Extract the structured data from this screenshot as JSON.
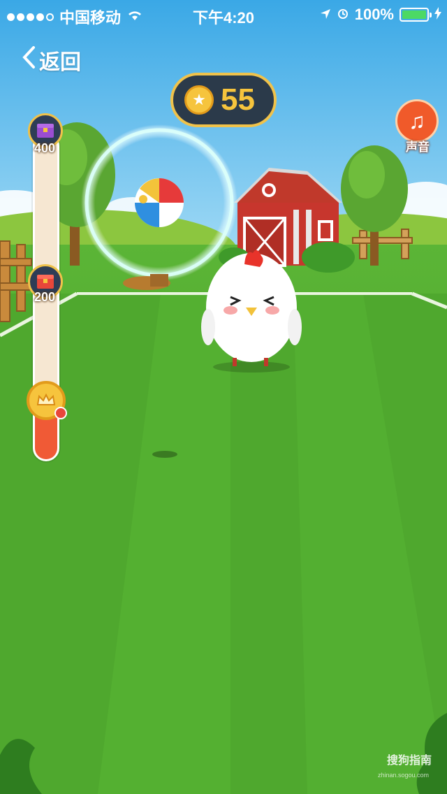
{
  "status_bar": {
    "carrier": "中国移动",
    "time": "下午4:20",
    "battery": "100%",
    "signal_bars_filled": 4,
    "signal_bars_total": 5
  },
  "nav": {
    "back_label": "返回"
  },
  "coins": {
    "value": "55"
  },
  "sound": {
    "label": "声音"
  },
  "progress": {
    "milestones": [
      "400",
      "200"
    ],
    "fill_fraction": 0.2
  },
  "watermark": {
    "text": "搜狗指南",
    "sub": "zhinan.sogou.com"
  },
  "colors": {
    "sky_top": "#3aa8e6",
    "grass": "#4aa22c",
    "coin": "#f6c43d",
    "accent_red": "#f05a36"
  }
}
